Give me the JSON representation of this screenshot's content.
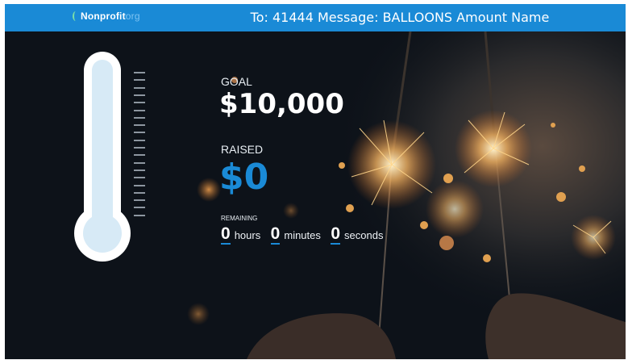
{
  "header": {
    "logo_main": "Nonprofit",
    "logo_suffix": "org",
    "message": "To: 41444 Message: BALLOONS Amount Name"
  },
  "goal": {
    "label": "GOAL",
    "value": "$10,000"
  },
  "raised": {
    "label": "RAISED",
    "value": "$0"
  },
  "remaining": {
    "label": "REMAINING",
    "hours": "0",
    "hours_label": "hours",
    "minutes": "0",
    "minutes_label": "minutes",
    "seconds": "0",
    "seconds_label": "seconds"
  },
  "thermometer": {
    "fill_fraction": 0
  },
  "colors": {
    "accent": "#1a8ad6",
    "background": "#0d1219",
    "mercury": "#d7eaf6"
  }
}
